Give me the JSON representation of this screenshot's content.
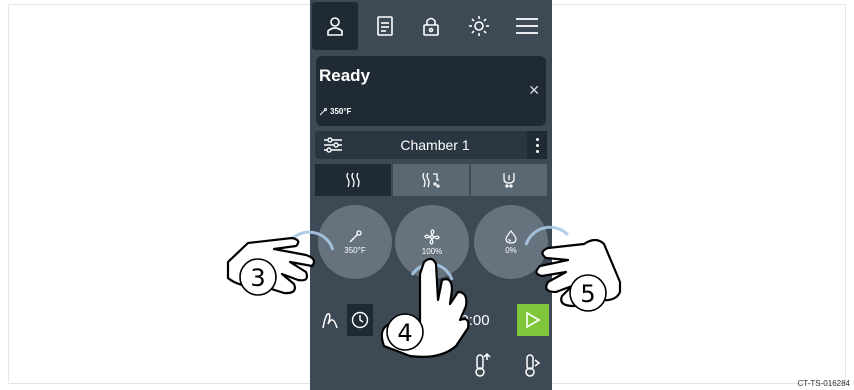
{
  "status": {
    "title": "Ready",
    "temperature": "350°F"
  },
  "chamber": {
    "name": "Chamber 1"
  },
  "dials": [
    {
      "icon": "probe-icon",
      "value": "350°F"
    },
    {
      "icon": "fan-icon",
      "value": "100%"
    },
    {
      "icon": "humidity-icon",
      "value": "0%"
    }
  ],
  "timer": {
    "value": "0:00"
  },
  "callouts": [
    "3",
    "4",
    "5"
  ],
  "doc_id": "CT-TS-016284",
  "colors": {
    "accent_green": "#7fc63a",
    "panel": "#3d4a56",
    "dark": "#1f2a34"
  }
}
